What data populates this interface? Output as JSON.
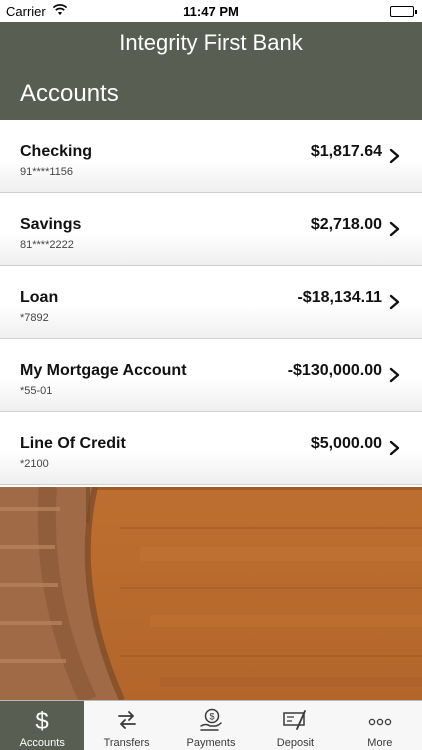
{
  "status_bar": {
    "carrier": "Carrier",
    "time": "11:47 PM"
  },
  "nav": {
    "title": "Integrity First Bank"
  },
  "section": {
    "title": "Accounts"
  },
  "accounts": [
    {
      "name": "Checking",
      "number": "91****1156",
      "balance": "$1,817.64"
    },
    {
      "name": "Savings",
      "number": "81****2222",
      "balance": "$2,718.00"
    },
    {
      "name": "Loan",
      "number": "*7892",
      "balance": "-$18,134.11"
    },
    {
      "name": "My Mortgage Account",
      "number": "*55-01",
      "balance": "-$130,000.00"
    },
    {
      "name": "Line Of Credit",
      "number": "*2100",
      "balance": "$5,000.00"
    }
  ],
  "tabs": [
    {
      "label": "Accounts",
      "icon": "dollar-icon",
      "active": true
    },
    {
      "label": "Transfers",
      "icon": "transfer-arrows-icon"
    },
    {
      "label": "Payments",
      "icon": "payment-hand-icon"
    },
    {
      "label": "Deposit",
      "icon": "check-deposit-icon"
    },
    {
      "label": "More",
      "icon": "more-dots-icon"
    }
  ],
  "colors": {
    "header": "#585e51",
    "wood": "#b66a2e",
    "tab_active": "#585e51"
  }
}
